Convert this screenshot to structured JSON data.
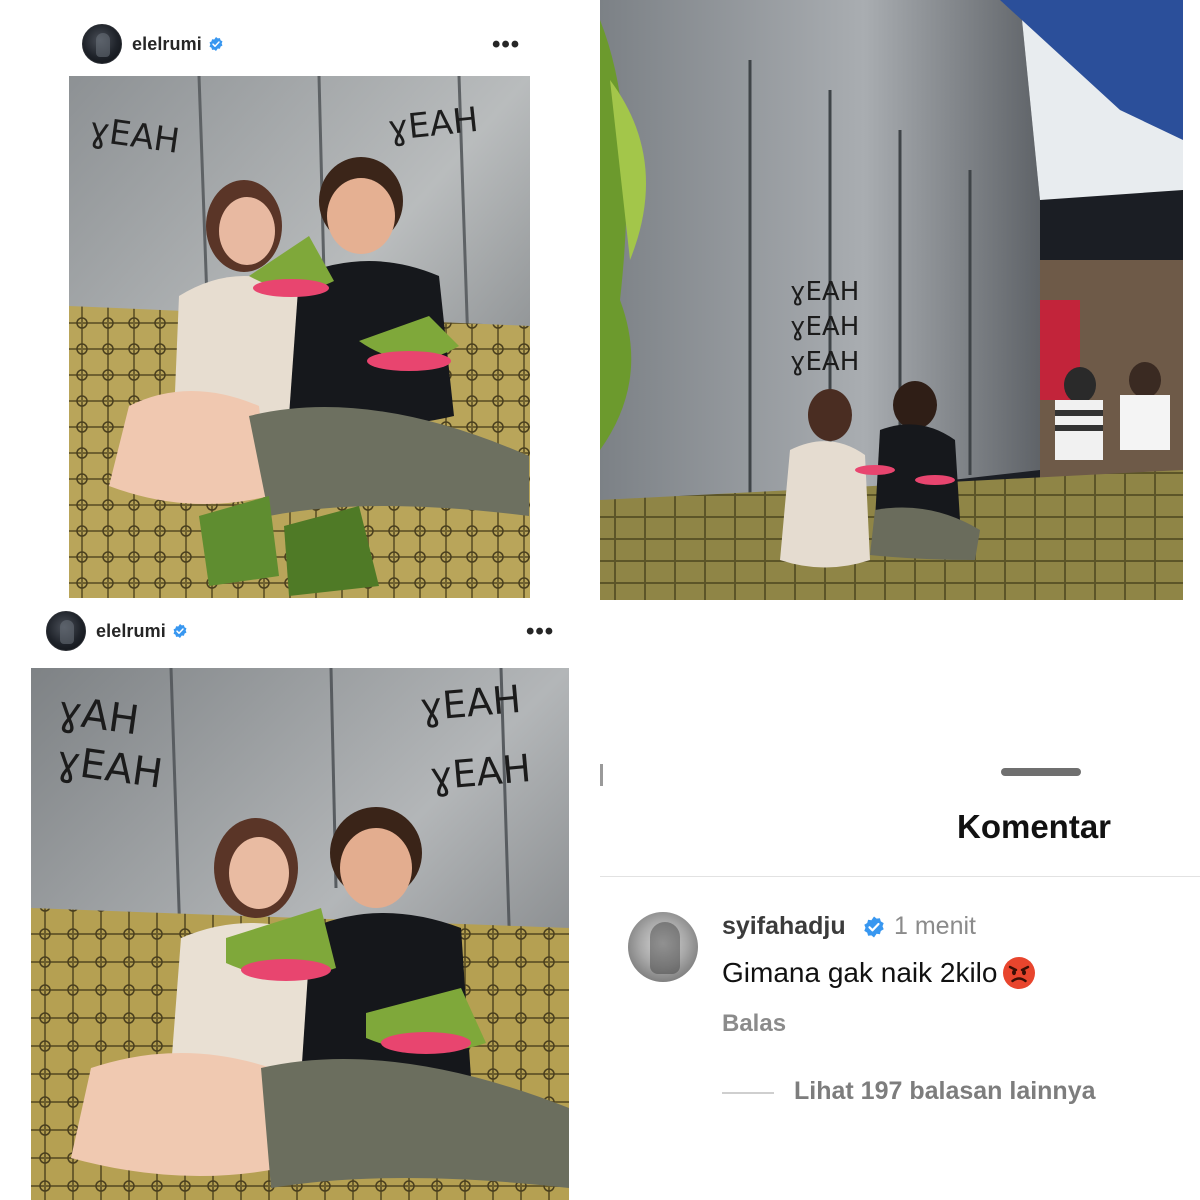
{
  "posts": [
    {
      "username": "elelrumi",
      "verified": true,
      "more_icon": "more-horizontal-icon",
      "more_label": "•••"
    },
    {
      "username": "elelrumi",
      "verified": true,
      "more_icon": "more-horizontal-icon",
      "more_label": "•••"
    }
  ],
  "comments_panel": {
    "title": "Komentar",
    "comment": {
      "username": "syifahadju",
      "verified": true,
      "time": "1 menit",
      "text": "Gimana gak naik 2kilo",
      "emoji": "angry-face-emoji",
      "reply_label": "Balas",
      "view_replies": "Lihat 197 balasan lainnya"
    }
  },
  "colors": {
    "verified_blue": "#3897f0",
    "text_primary": "#262626",
    "text_secondary": "#8b8b8b",
    "banana_leaf": "#7fa83a",
    "plate_pink": "#e8456f"
  }
}
